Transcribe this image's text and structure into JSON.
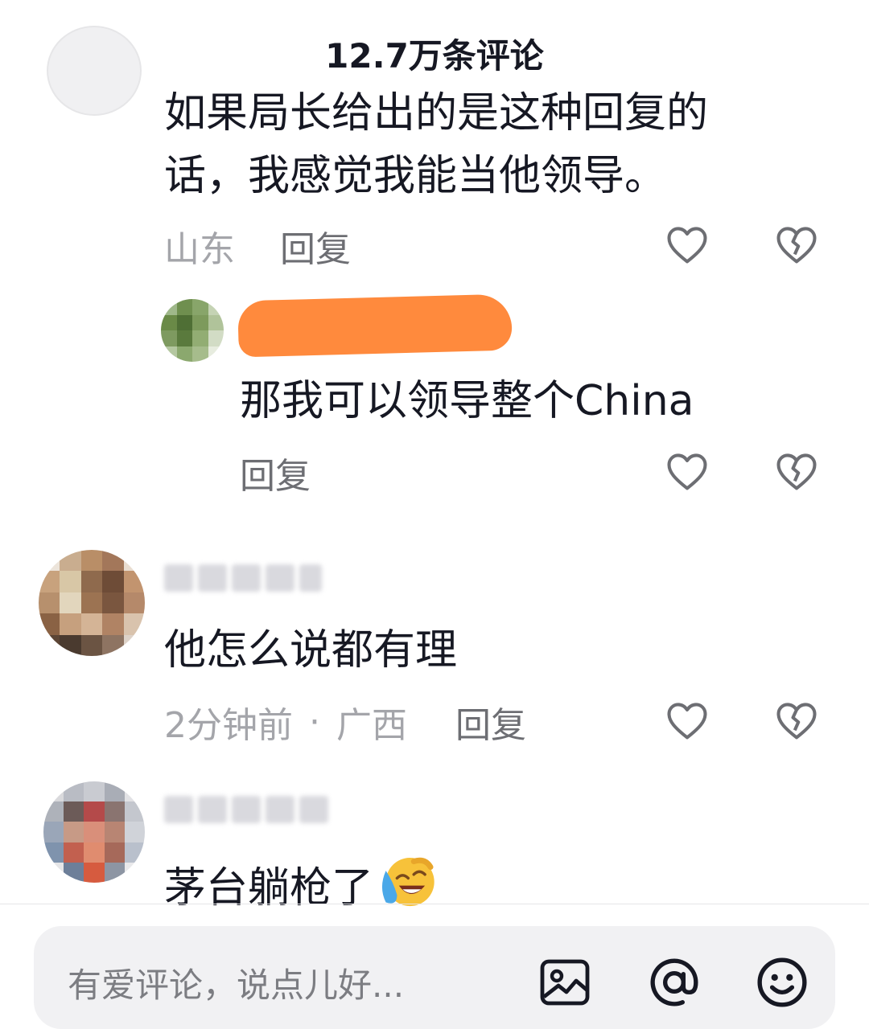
{
  "header": {
    "title": "12.7万条评论"
  },
  "comments": [
    {
      "text_line1": "如果局长给出的是这种回复的",
      "text_line2": "话，我感觉我能当他领导。",
      "location": "山东",
      "reply_label": "回复",
      "reply": {
        "text": "那我可以领导整个China",
        "reply_label": "回复"
      }
    },
    {
      "text": "他怎么说都有理",
      "time": "2分钟前",
      "separator": "·",
      "location": "广西",
      "reply_label": "回复"
    },
    {
      "text": "茅台躺枪了",
      "emoji": "face-with-tears-of-joy"
    }
  ],
  "input": {
    "placeholder": "有爱评论，说点儿好..."
  },
  "icons": {
    "like": "heart-outline-icon",
    "dislike": "broken-heart-icon",
    "image": "image-icon",
    "mention": "at-icon",
    "emoji": "smiley-icon"
  },
  "colors": {
    "text": "#161823",
    "meta": "#a4a5aa",
    "reply": "#6d6e73",
    "redaction": "#ff8a3d",
    "input_bg": "#f1f1f3"
  }
}
